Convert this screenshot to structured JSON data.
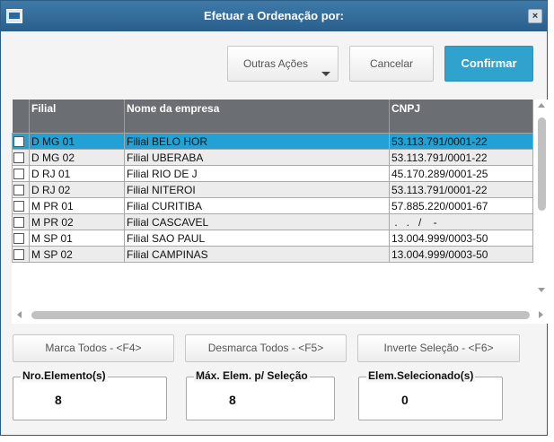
{
  "dialog": {
    "title": "Efetuar a Ordenação por:",
    "close_label": "×"
  },
  "toolbar": {
    "other_actions_label": "Outras Ações",
    "cancel_label": "Cancelar",
    "confirm_label": "Confirmar"
  },
  "grid": {
    "columns": [
      "Filial",
      "Nome da empresa",
      "CNPJ"
    ],
    "rows": [
      {
        "filial": "D MG 01",
        "nome": "Filial BELO HOR",
        "cnpj": "53.113.791/0001-22"
      },
      {
        "filial": "D MG 02",
        "nome": "Filial UBERABA",
        "cnpj": "53.113.791/0001-22"
      },
      {
        "filial": "D RJ 01",
        "nome": "Filial RIO DE J",
        "cnpj": "45.170.289/0001-25"
      },
      {
        "filial": "D RJ 02",
        "nome": "Filial NITEROI",
        "cnpj": "53.113.791/0001-22"
      },
      {
        "filial": "M PR 01",
        "nome": "Filial CURITIBA",
        "cnpj": "57.885.220/0001-67"
      },
      {
        "filial": "M PR 02",
        "nome": "Filial CASCAVEL",
        "cnpj": " .   .   /    -"
      },
      {
        "filial": "M SP 01",
        "nome": "Filial SAO PAUL",
        "cnpj": "13.004.999/0003-50"
      },
      {
        "filial": "M SP 02",
        "nome": "Filial CAMPINAS",
        "cnpj": "13.004.999/0003-50"
      }
    ]
  },
  "actions": {
    "mark_all": "Marca Todos - <F4>",
    "unmark_all": "Desmarca Todos - <F5>",
    "invert": "Inverte Seleção - <F6>"
  },
  "counters": {
    "elements_label": "Nro.Elemento(s)",
    "elements_value": "8",
    "max_label": "Máx. Elem. p/ Seleção",
    "max_value": "8",
    "selected_label": "Elem.Selecionado(s)",
    "selected_value": "0"
  },
  "colors": {
    "titlebar": "#2f6895",
    "confirm": "#2fa2cd",
    "selected_row": "#22a2d4",
    "header": "#6b6e72"
  }
}
